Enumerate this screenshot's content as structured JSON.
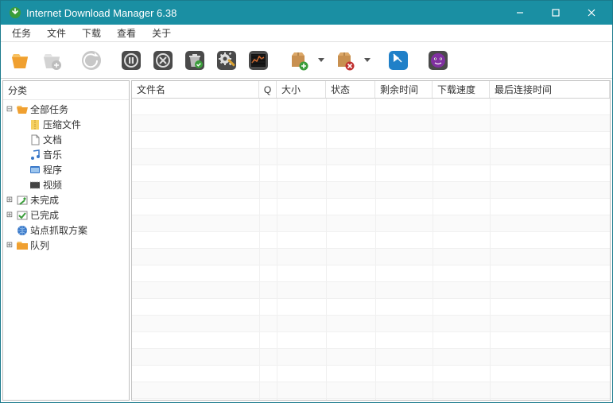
{
  "window": {
    "title": "Internet Download Manager 6.38"
  },
  "menu": {
    "items": [
      "任务",
      "文件",
      "下载",
      "查看",
      "关于"
    ]
  },
  "toolbar": {
    "addUrl": "add-url",
    "addBatch": "add-batch",
    "resume": "resume",
    "stop": "stop",
    "stopAll": "stop-all",
    "delete": "delete",
    "options": "options",
    "scheduler": "scheduler",
    "startQueue": "start-queue",
    "stopQueue": "stop-queue",
    "grabber": "grabber",
    "tellFriend": "tell-friend"
  },
  "sidebar": {
    "header": "分类",
    "nodes": {
      "all": "全部任务",
      "compressed": "压缩文件",
      "documents": "文档",
      "music": "音乐",
      "programs": "程序",
      "video": "视频",
      "unfinished": "未完成",
      "finished": "已完成",
      "grabber": "站点抓取方案",
      "queues": "队列"
    }
  },
  "grid": {
    "columns": {
      "filename": "文件名",
      "q": "Q",
      "size": "大小",
      "status": "状态",
      "timeleft": "剩余时间",
      "speed": "下载速度",
      "lastconn": "最后连接时间"
    },
    "rows": []
  }
}
